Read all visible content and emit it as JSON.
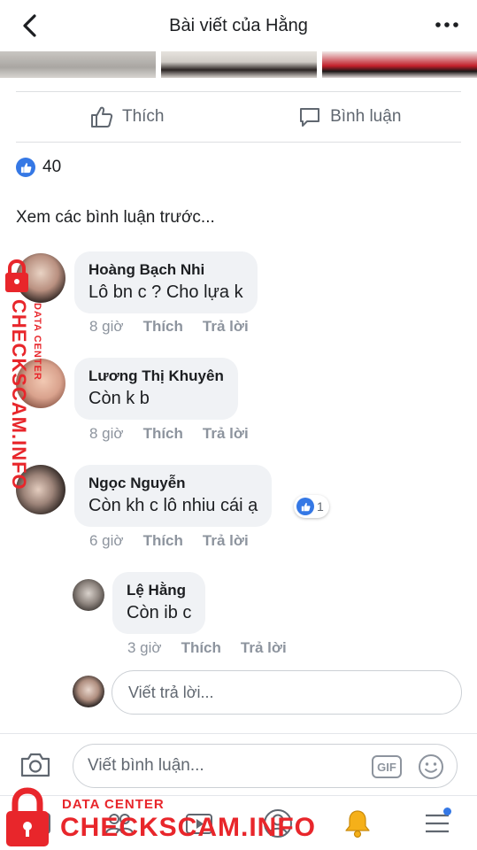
{
  "header": {
    "title": "Bài viết của Hằng"
  },
  "actions": {
    "like_label": "Thích",
    "comment_label": "Bình luận"
  },
  "reactions": {
    "count": "40"
  },
  "previous_comments_label": "Xem các bình luận trước...",
  "comments": [
    {
      "name": "Hoàng Bạch Nhi",
      "text": "Lô bn c ? Cho lựa k",
      "time": "8 giờ",
      "like": "Thích",
      "reply": "Trả lời"
    },
    {
      "name": "Lương Thị Khuyên",
      "text": "Còn k b",
      "time": "8 giờ",
      "like": "Thích",
      "reply": "Trả lời"
    },
    {
      "name": "Ngọc Nguyễn",
      "text": "Còn kh c lô nhiu cái ạ",
      "time": "6 giờ",
      "like": "Thích",
      "reply": "Trả lời",
      "reaction_count": "1"
    }
  ],
  "reply": {
    "name": "Lệ Hằng",
    "text": "Còn ib c",
    "time": "3 giờ",
    "like": "Thích",
    "reply": "Trả lời"
  },
  "reply_input": {
    "placeholder": "Viết trả lời..."
  },
  "composer": {
    "placeholder": "Viết bình luận...",
    "gif_label": "GIF"
  },
  "watermark": {
    "small": "DATA CENTER",
    "big": "CHECKSCAM.INFO"
  },
  "colors": {
    "accent": "#3578e5",
    "watermark": "#e8262b",
    "bubble": "#f0f2f5"
  }
}
